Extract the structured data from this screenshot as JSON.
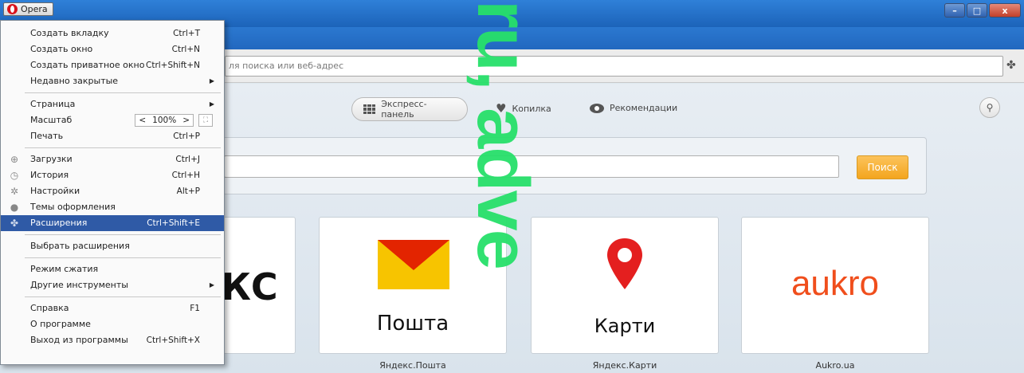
{
  "titlebar": {
    "opera_label": "Opera",
    "minimize": "–",
    "maximize": "□",
    "close": "x"
  },
  "address_bar": {
    "placeholder": "ля поиска или веб-адрес"
  },
  "speeddial_nav": {
    "express": "Экспресс-панель",
    "stash": "Копилка",
    "recommendations": "Рекомендации"
  },
  "search": {
    "button": "Поиск"
  },
  "tiles": [
    {
      "title": "кс",
      "caption": ""
    },
    {
      "title": "Пошта",
      "caption": "Яндекс.Пошта"
    },
    {
      "title": "Карти",
      "caption": "Яндекс.Карти"
    },
    {
      "title": "aukro",
      "caption": "Aukro.ua"
    }
  ],
  "watermark": "ru, adve",
  "menu": {
    "new_tab": {
      "label": "Создать вкладку",
      "shortcut": "Ctrl+T"
    },
    "new_window": {
      "label": "Создать окно",
      "shortcut": "Ctrl+N"
    },
    "new_private": {
      "label": "Создать приватное окно",
      "shortcut": "Ctrl+Shift+N"
    },
    "recently_closed": {
      "label": "Недавно закрытые"
    },
    "page": {
      "label": "Страница"
    },
    "zoom": {
      "label": "Масштаб",
      "value": "100%"
    },
    "print": {
      "label": "Печать",
      "shortcut": "Ctrl+P"
    },
    "downloads": {
      "label": "Загрузки",
      "shortcut": "Ctrl+J"
    },
    "history": {
      "label": "История",
      "shortcut": "Ctrl+H"
    },
    "settings": {
      "label": "Настройки",
      "shortcut": "Alt+P"
    },
    "themes": {
      "label": "Темы оформления"
    },
    "extensions": {
      "label": "Расширения",
      "shortcut": "Ctrl+Shift+E"
    },
    "choose_extensions": {
      "label": "Выбрать расширения"
    },
    "turbo": {
      "label": "Режим сжатия"
    },
    "other_tools": {
      "label": "Другие инструменты"
    },
    "help": {
      "label": "Справка",
      "shortcut": "F1"
    },
    "about": {
      "label": "О программе"
    },
    "exit": {
      "label": "Выход из программы",
      "shortcut": "Ctrl+Shift+X"
    }
  }
}
